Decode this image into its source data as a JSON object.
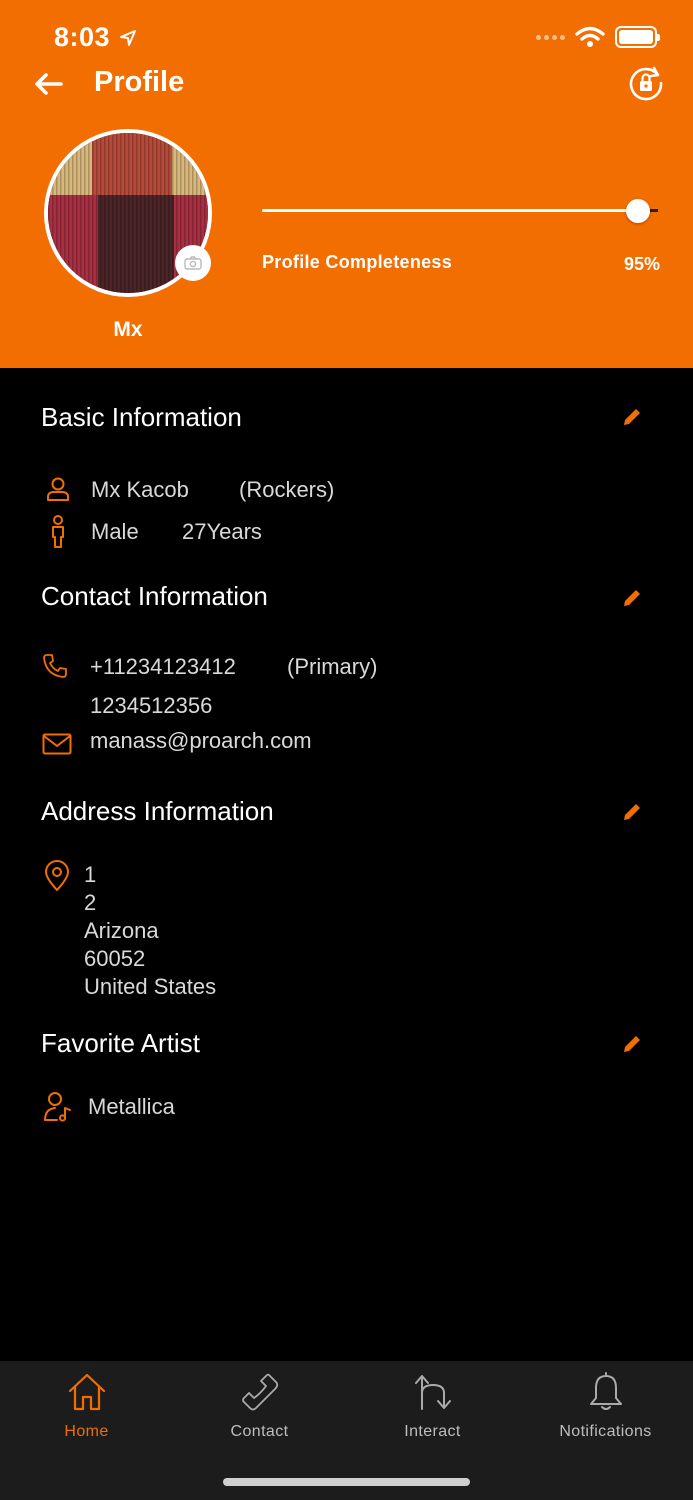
{
  "status_bar": {
    "time": "8:03"
  },
  "header": {
    "title": "Profile",
    "user_short_name": "Mx",
    "completeness_label": "Profile Completeness",
    "completeness_text": "95%",
    "completeness_value": 0.95
  },
  "basic_info": {
    "title": "Basic Information",
    "name": "Mx Kacob",
    "group": "(Rockers)",
    "gender": "Male",
    "age": "27Years"
  },
  "contact_info": {
    "title": "Contact Information",
    "phone_primary": "+11234123412",
    "phone_primary_tag": "(Primary)",
    "phone_secondary": "1234512356",
    "email": "manass@proarch.com"
  },
  "address_info": {
    "title": "Address Information",
    "lines": [
      "1",
      "2",
      "Arizona",
      "60052",
      "United States"
    ]
  },
  "favorite_artist": {
    "title": "Favorite Artist",
    "artist": "Metallica"
  },
  "tabbar": {
    "items": [
      {
        "label": "Home",
        "icon": "home-icon",
        "active": true
      },
      {
        "label": "Contact",
        "icon": "phone-icon",
        "active": false
      },
      {
        "label": "Interact",
        "icon": "interact-arrows-icon",
        "active": false
      },
      {
        "label": "Notifications",
        "icon": "bell-icon",
        "active": false
      }
    ]
  },
  "colors": {
    "accent": "#F26E00",
    "background": "#000000",
    "tabbar_background": "#1C1C1C",
    "text_secondary": "#D9D9D9"
  }
}
